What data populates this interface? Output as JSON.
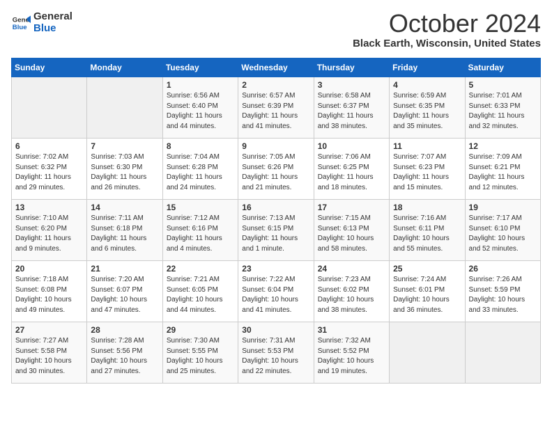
{
  "header": {
    "logo_line1": "General",
    "logo_line2": "Blue",
    "month": "October 2024",
    "location": "Black Earth, Wisconsin, United States"
  },
  "days_of_week": [
    "Sunday",
    "Monday",
    "Tuesday",
    "Wednesday",
    "Thursday",
    "Friday",
    "Saturday"
  ],
  "weeks": [
    [
      {
        "num": "",
        "sunrise": "",
        "sunset": "",
        "daylight": ""
      },
      {
        "num": "",
        "sunrise": "",
        "sunset": "",
        "daylight": ""
      },
      {
        "num": "1",
        "sunrise": "Sunrise: 6:56 AM",
        "sunset": "Sunset: 6:40 PM",
        "daylight": "Daylight: 11 hours and 44 minutes."
      },
      {
        "num": "2",
        "sunrise": "Sunrise: 6:57 AM",
        "sunset": "Sunset: 6:39 PM",
        "daylight": "Daylight: 11 hours and 41 minutes."
      },
      {
        "num": "3",
        "sunrise": "Sunrise: 6:58 AM",
        "sunset": "Sunset: 6:37 PM",
        "daylight": "Daylight: 11 hours and 38 minutes."
      },
      {
        "num": "4",
        "sunrise": "Sunrise: 6:59 AM",
        "sunset": "Sunset: 6:35 PM",
        "daylight": "Daylight: 11 hours and 35 minutes."
      },
      {
        "num": "5",
        "sunrise": "Sunrise: 7:01 AM",
        "sunset": "Sunset: 6:33 PM",
        "daylight": "Daylight: 11 hours and 32 minutes."
      }
    ],
    [
      {
        "num": "6",
        "sunrise": "Sunrise: 7:02 AM",
        "sunset": "Sunset: 6:32 PM",
        "daylight": "Daylight: 11 hours and 29 minutes."
      },
      {
        "num": "7",
        "sunrise": "Sunrise: 7:03 AM",
        "sunset": "Sunset: 6:30 PM",
        "daylight": "Daylight: 11 hours and 26 minutes."
      },
      {
        "num": "8",
        "sunrise": "Sunrise: 7:04 AM",
        "sunset": "Sunset: 6:28 PM",
        "daylight": "Daylight: 11 hours and 24 minutes."
      },
      {
        "num": "9",
        "sunrise": "Sunrise: 7:05 AM",
        "sunset": "Sunset: 6:26 PM",
        "daylight": "Daylight: 11 hours and 21 minutes."
      },
      {
        "num": "10",
        "sunrise": "Sunrise: 7:06 AM",
        "sunset": "Sunset: 6:25 PM",
        "daylight": "Daylight: 11 hours and 18 minutes."
      },
      {
        "num": "11",
        "sunrise": "Sunrise: 7:07 AM",
        "sunset": "Sunset: 6:23 PM",
        "daylight": "Daylight: 11 hours and 15 minutes."
      },
      {
        "num": "12",
        "sunrise": "Sunrise: 7:09 AM",
        "sunset": "Sunset: 6:21 PM",
        "daylight": "Daylight: 11 hours and 12 minutes."
      }
    ],
    [
      {
        "num": "13",
        "sunrise": "Sunrise: 7:10 AM",
        "sunset": "Sunset: 6:20 PM",
        "daylight": "Daylight: 11 hours and 9 minutes."
      },
      {
        "num": "14",
        "sunrise": "Sunrise: 7:11 AM",
        "sunset": "Sunset: 6:18 PM",
        "daylight": "Daylight: 11 hours and 6 minutes."
      },
      {
        "num": "15",
        "sunrise": "Sunrise: 7:12 AM",
        "sunset": "Sunset: 6:16 PM",
        "daylight": "Daylight: 11 hours and 4 minutes."
      },
      {
        "num": "16",
        "sunrise": "Sunrise: 7:13 AM",
        "sunset": "Sunset: 6:15 PM",
        "daylight": "Daylight: 11 hours and 1 minute."
      },
      {
        "num": "17",
        "sunrise": "Sunrise: 7:15 AM",
        "sunset": "Sunset: 6:13 PM",
        "daylight": "Daylight: 10 hours and 58 minutes."
      },
      {
        "num": "18",
        "sunrise": "Sunrise: 7:16 AM",
        "sunset": "Sunset: 6:11 PM",
        "daylight": "Daylight: 10 hours and 55 minutes."
      },
      {
        "num": "19",
        "sunrise": "Sunrise: 7:17 AM",
        "sunset": "Sunset: 6:10 PM",
        "daylight": "Daylight: 10 hours and 52 minutes."
      }
    ],
    [
      {
        "num": "20",
        "sunrise": "Sunrise: 7:18 AM",
        "sunset": "Sunset: 6:08 PM",
        "daylight": "Daylight: 10 hours and 49 minutes."
      },
      {
        "num": "21",
        "sunrise": "Sunrise: 7:20 AM",
        "sunset": "Sunset: 6:07 PM",
        "daylight": "Daylight: 10 hours and 47 minutes."
      },
      {
        "num": "22",
        "sunrise": "Sunrise: 7:21 AM",
        "sunset": "Sunset: 6:05 PM",
        "daylight": "Daylight: 10 hours and 44 minutes."
      },
      {
        "num": "23",
        "sunrise": "Sunrise: 7:22 AM",
        "sunset": "Sunset: 6:04 PM",
        "daylight": "Daylight: 10 hours and 41 minutes."
      },
      {
        "num": "24",
        "sunrise": "Sunrise: 7:23 AM",
        "sunset": "Sunset: 6:02 PM",
        "daylight": "Daylight: 10 hours and 38 minutes."
      },
      {
        "num": "25",
        "sunrise": "Sunrise: 7:24 AM",
        "sunset": "Sunset: 6:01 PM",
        "daylight": "Daylight: 10 hours and 36 minutes."
      },
      {
        "num": "26",
        "sunrise": "Sunrise: 7:26 AM",
        "sunset": "Sunset: 5:59 PM",
        "daylight": "Daylight: 10 hours and 33 minutes."
      }
    ],
    [
      {
        "num": "27",
        "sunrise": "Sunrise: 7:27 AM",
        "sunset": "Sunset: 5:58 PM",
        "daylight": "Daylight: 10 hours and 30 minutes."
      },
      {
        "num": "28",
        "sunrise": "Sunrise: 7:28 AM",
        "sunset": "Sunset: 5:56 PM",
        "daylight": "Daylight: 10 hours and 27 minutes."
      },
      {
        "num": "29",
        "sunrise": "Sunrise: 7:30 AM",
        "sunset": "Sunset: 5:55 PM",
        "daylight": "Daylight: 10 hours and 25 minutes."
      },
      {
        "num": "30",
        "sunrise": "Sunrise: 7:31 AM",
        "sunset": "Sunset: 5:53 PM",
        "daylight": "Daylight: 10 hours and 22 minutes."
      },
      {
        "num": "31",
        "sunrise": "Sunrise: 7:32 AM",
        "sunset": "Sunset: 5:52 PM",
        "daylight": "Daylight: 10 hours and 19 minutes."
      },
      {
        "num": "",
        "sunrise": "",
        "sunset": "",
        "daylight": ""
      },
      {
        "num": "",
        "sunrise": "",
        "sunset": "",
        "daylight": ""
      }
    ]
  ]
}
